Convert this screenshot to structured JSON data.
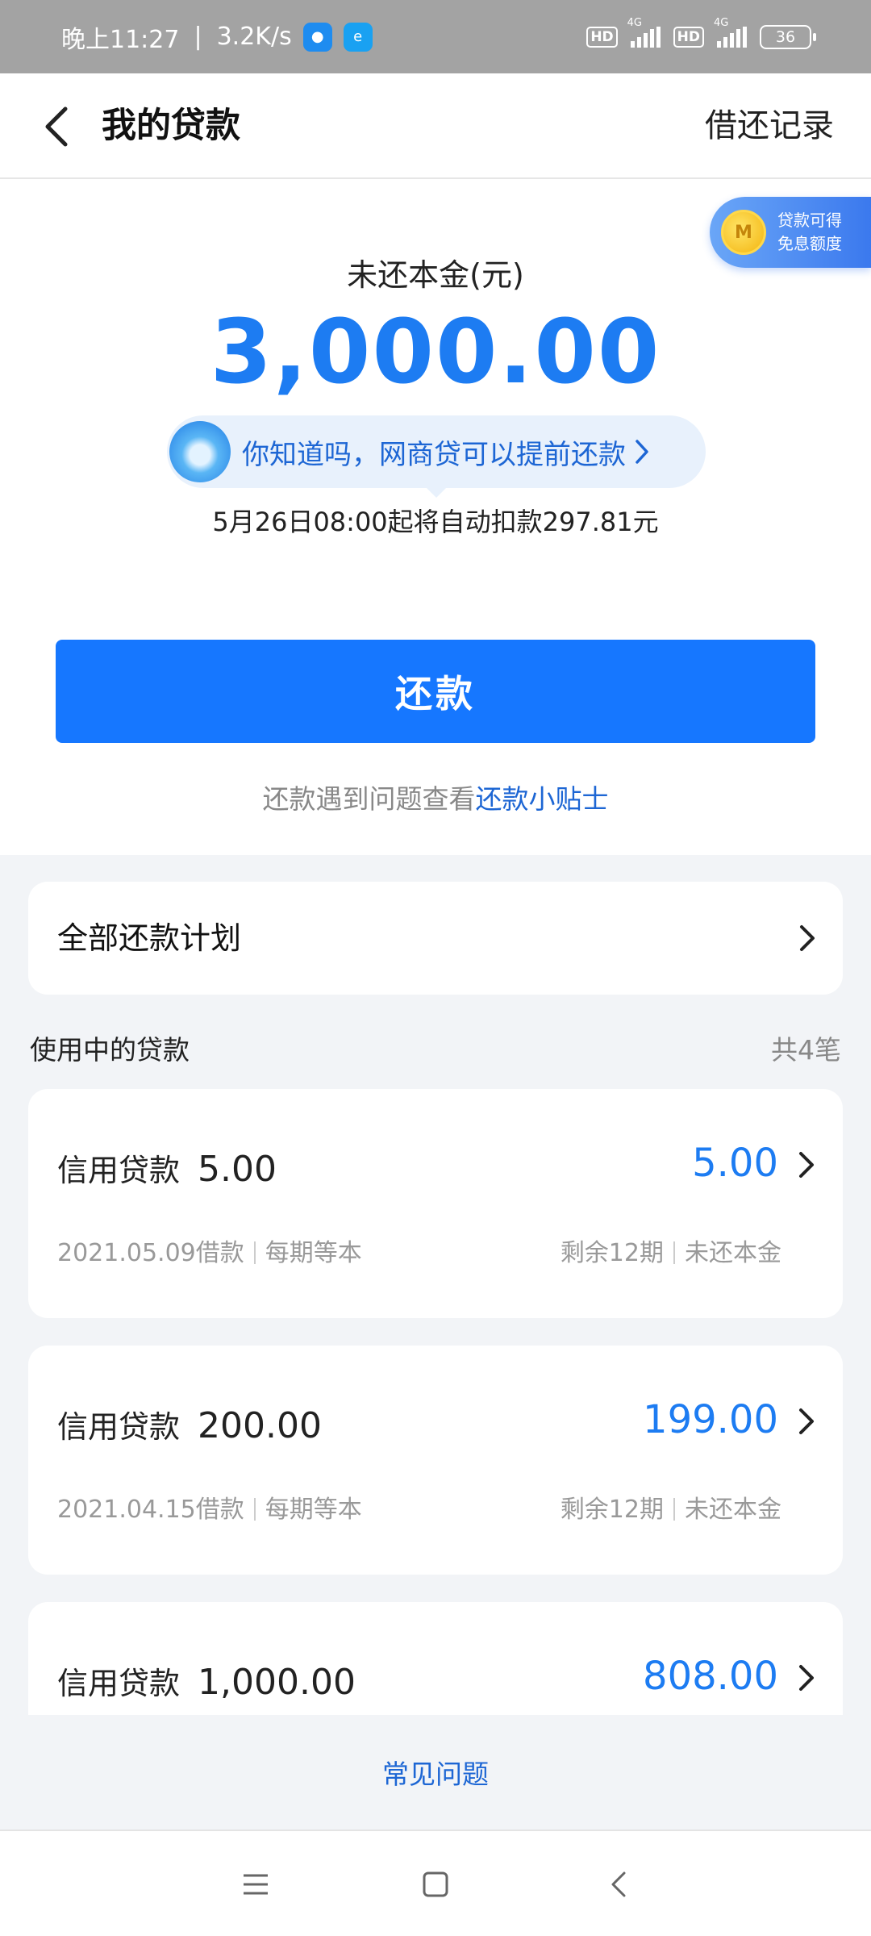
{
  "status_bar": {
    "time": "晚上11:27",
    "separator": "|",
    "net_speed": "3.2K/s",
    "hd1": "HD",
    "hd2": "HD",
    "net1": "4G",
    "net2": "4G",
    "battery": "36"
  },
  "header": {
    "title": "我的贷款",
    "right_link": "借还记录"
  },
  "coupon": {
    "line1": "贷款可得",
    "line2": "免息额度"
  },
  "summary": {
    "label": "未还本金(元)",
    "amount": "3,000.00",
    "tip": "你知道吗，网商贷可以提前还款",
    "auto_debit": "5月26日08:00起将自动扣款297.81元",
    "repay_button": "还款",
    "help_prefix": "还款遇到问题查看",
    "help_link": "还款小贴士"
  },
  "plan": {
    "label": "全部还款计划"
  },
  "loans_section": {
    "title": "使用中的贷款",
    "count": "共4笔",
    "items": [
      {
        "type": "信用贷款",
        "amount": "5.00",
        "remaining": "5.00",
        "date": "2021.05.09借款",
        "method": "每期等本",
        "periods": "剩余12期",
        "remaining_label": "未还本金"
      },
      {
        "type": "信用贷款",
        "amount": "200.00",
        "remaining": "199.00",
        "date": "2021.04.15借款",
        "method": "每期等本",
        "periods": "剩余12期",
        "remaining_label": "未还本金"
      },
      {
        "type": "信用贷款",
        "amount": "1,000.00",
        "remaining": "808.00"
      }
    ]
  },
  "footer": {
    "faq": "常见问题"
  },
  "colors": {
    "accent": "#1677ff",
    "amount_blue": "#1d7cf2",
    "status_bar": "#a3a3a3"
  }
}
